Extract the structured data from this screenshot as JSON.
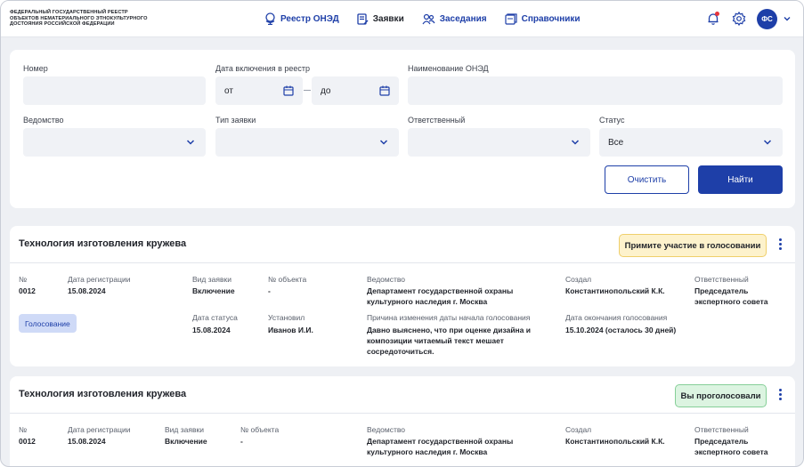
{
  "header": {
    "org_lines": [
      "ФЕДЕРАЛЬНЫЙ ГОСУДАРСТВЕННЫЙ РЕЕСТР",
      "ОБЪЕКТОВ НЕМАТЕРИАЛЬНОГО ЭТНОКУЛЬТУРНОГО",
      "ДОСТОЯНИЯ РОССИЙСКОЙ ФЕДЕРАЦИИ"
    ],
    "nav": [
      {
        "label": "Реестр ОНЭД",
        "icon": "globe-icon",
        "active": false
      },
      {
        "label": "Заявки",
        "icon": "document-icon",
        "active": true
      },
      {
        "label": "Заседания",
        "icon": "users-icon",
        "active": false
      },
      {
        "label": "Справочники",
        "icon": "book-icon",
        "active": false
      }
    ],
    "avatar_initials": "ФС"
  },
  "filters": {
    "number_label": "Номер",
    "date_label": "Дата включения в реестр",
    "date_from_placeholder": "от",
    "date_to_placeholder": "до",
    "name_label": "Наименование ОНЭД",
    "agency_label": "Ведомство",
    "type_label": "Тип заявки",
    "responsible_label": "Ответственный",
    "status_label": "Статус",
    "status_value": "Все",
    "clear_label": "Очистить",
    "find_label": "Найти"
  },
  "cards": [
    {
      "title": "Технология изготовления кружева",
      "badge": "Примите участие в голосовании",
      "number_label": "№",
      "number": "0012",
      "reg_date_label": "Дата регистрации",
      "reg_date": "15.08.2024",
      "type_label": "Вид заявки",
      "type": "Включение",
      "object_label": "№ объекта",
      "object": "-",
      "agency_label": "Ведомство",
      "agency": "Департамент государственной охраны культурного наследия г. Москва",
      "creator_label": "Создал",
      "creator": "Константинопольский К.К.",
      "responsible_label": "Ответственный",
      "responsible": "Председатель экспертного совета",
      "tag": "Голосование",
      "status_date_label": "Дата статуса",
      "status_date": "15.08.2024",
      "setter_label": "Установил",
      "setter": "Иванов И.И.",
      "reason_label": "Причина изменения даты начала голосования",
      "reason": "Давно выяснено, что при оценке дизайна и композиции читаемый текст мешает сосредоточиться.",
      "end_label": "Дата окончания голосования",
      "end": "15.10.2024 (осталось 30 дней)"
    },
    {
      "title": "Технология изготовления кружева",
      "badge": "Вы проголосовали",
      "number_label": "№",
      "number": "0012",
      "reg_date_label": "Дата регистрации",
      "reg_date": "15.08.2024",
      "type_label": "Вид заявки",
      "type": "Включение",
      "object_label": "№ объекта",
      "object": "-",
      "agency_label": "Ведомство",
      "agency": "Департамент государственной охраны культурного наследия г. Москва",
      "creator_label": "Создал",
      "creator": "Константинопольский К.К.",
      "responsible_label": "Ответственный",
      "responsible": "Председатель экспертного совета"
    }
  ]
}
